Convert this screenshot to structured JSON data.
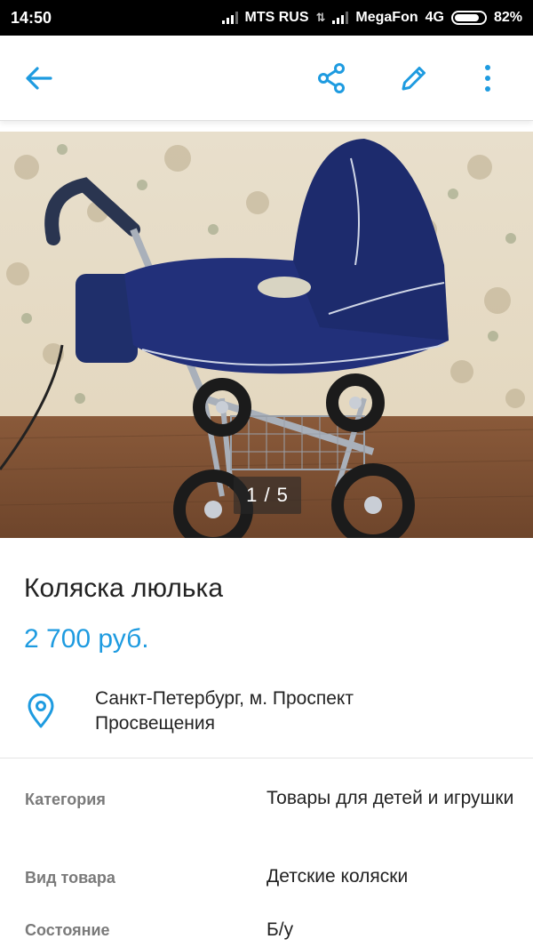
{
  "status_bar": {
    "time": "14:50",
    "carrier1": "MTS RUS",
    "carrier2": "MegaFon",
    "network": "4G",
    "battery": "82%"
  },
  "app_bar": {
    "back_icon": "arrow-left-icon",
    "share_icon": "share-icon",
    "edit_icon": "pencil-icon",
    "more_icon": "more-vertical-icon",
    "accent_color": "#1e9be0"
  },
  "photo": {
    "counter": "1 / 5"
  },
  "listing": {
    "title": "Коляска люлька",
    "price": "2 700 руб.",
    "location_icon": "location-pin-icon",
    "location": "Санкт-Петербург, м. Проспект Просвещения"
  },
  "params": [
    {
      "label": "Категория",
      "value": "Товары для детей и игрушки"
    },
    {
      "label": "Вид товара",
      "value": "Детские коляски"
    },
    {
      "label": "Состояние",
      "value": "Б/у"
    }
  ]
}
